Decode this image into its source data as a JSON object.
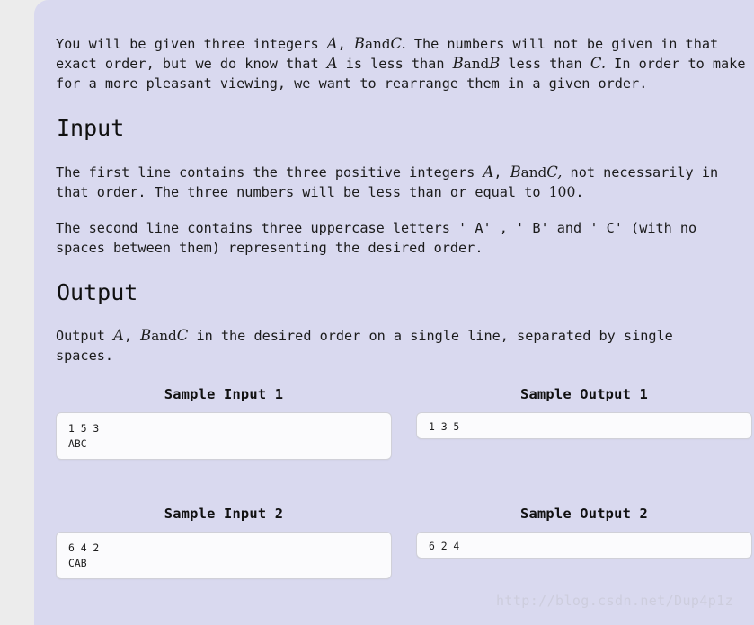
{
  "problem": {
    "intro_parts": {
      "t1": "You will be given three integers ",
      "v_a1": "A",
      "t2": ", ",
      "v_b1": "B",
      "t3": "and",
      "v_c1": "C.",
      "t4": " The numbers will not be given in that exact order, but we do know that ",
      "v_a2": "A",
      "t5": " is less than ",
      "v_b2": "B",
      "t6": "and",
      "v_b3": "B",
      "t7": " less than ",
      "v_c2": "C.",
      "t8": " In order to make for a more pleasant viewing, we want to rearrange them in a given order."
    },
    "input_heading": "Input",
    "input_para1_parts": {
      "t1": "The first line contains the three positive integers ",
      "v_a": "A",
      "t2": ", ",
      "v_b": "B",
      "t3": "and",
      "v_c": "C,",
      "t4": " not necessarily in that order. The three numbers will be less than or equal to ",
      "num": "100",
      "t5": "."
    },
    "input_para2": "The second line contains three uppercase letters ' A' , ' B'  and ' C'  (with no spaces between them) representing the desired order.",
    "output_heading": "Output",
    "output_para_parts": {
      "t1": "Output ",
      "v_a": "A",
      "t2": ", ",
      "v_b": "B",
      "t3": "and",
      "v_c": "C",
      "t4": " in the desired order on a single line, separated by single spaces."
    }
  },
  "samples": [
    {
      "input_title": "Sample Input 1",
      "input_text": "1 5 3\nABC",
      "output_title": "Sample Output 1",
      "output_text": "1 3 5"
    },
    {
      "input_title": "Sample Input 2",
      "input_text": "6 4 2\nCAB",
      "output_title": "Sample Output 2",
      "output_text": "6 2 4"
    }
  ],
  "watermark": "http://blog.csdn.net/Dup4p1z",
  "colors": {
    "page_background": "#ececec",
    "container_background": "#d9d9ef",
    "code_box_background": "#fbfbfd",
    "code_box_border": "#d0d0d8",
    "text": "#1b1b1b",
    "watermark": "#cdcddd"
  }
}
